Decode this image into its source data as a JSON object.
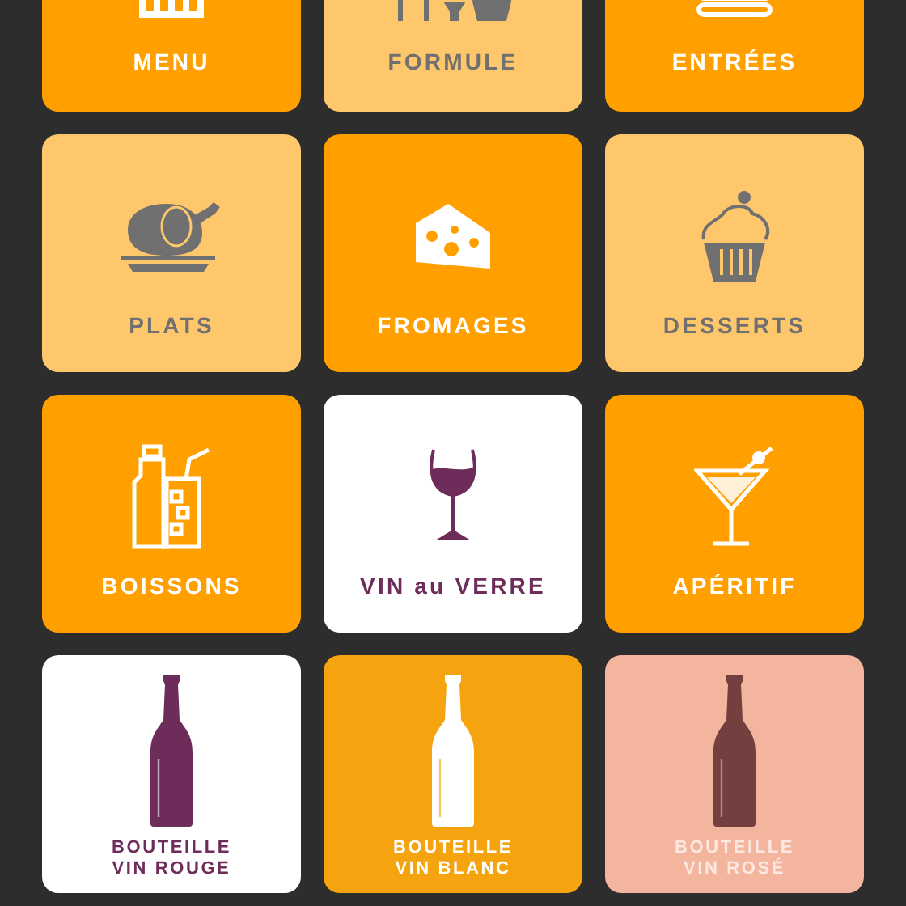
{
  "tiles": [
    {
      "label": "MENU",
      "color": "#ff9f00"
    },
    {
      "label": "FORMULE",
      "color": "#ffc76c"
    },
    {
      "label": "ENTRÉES",
      "color": "#ff9f00"
    },
    {
      "label": "PLATS",
      "color": "#ffc76c"
    },
    {
      "label": "FROMAGES",
      "color": "#ff9f00"
    },
    {
      "label": "DESSERTS",
      "color": "#ffc76c"
    },
    {
      "label": "BOISSONS",
      "color": "#ff9f00"
    },
    {
      "label": "VIN au VERRE",
      "color": "#ffffff"
    },
    {
      "label": "APÉRITIF",
      "color": "#ff9f00"
    },
    {
      "label": "BOUTEILLE\nVIN ROUGE",
      "color": "#ffffff"
    },
    {
      "label": "BOUTEILLE\nVIN BLANC",
      "color": "#f5a30f"
    },
    {
      "label": "BOUTEILLE\nVIN ROSÉ",
      "color": "#f4b59f"
    }
  ]
}
